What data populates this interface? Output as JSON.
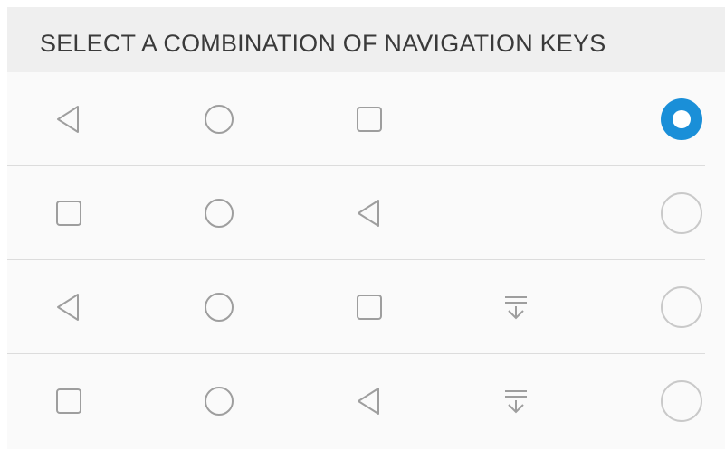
{
  "header": {
    "title": "SELECT A COMBINATION OF NAVIGATION KEYS"
  },
  "colors": {
    "accent": "#1a8fd8",
    "icon": "#9e9e9e",
    "divider": "#dcdcdc"
  },
  "options": [
    {
      "keys": [
        "back-icon",
        "home-icon",
        "recent-apps-icon"
      ],
      "selected": true
    },
    {
      "keys": [
        "recent-apps-icon",
        "home-icon",
        "back-icon"
      ],
      "selected": false
    },
    {
      "keys": [
        "back-icon",
        "home-icon",
        "recent-apps-icon",
        "notification-pull-down-icon"
      ],
      "selected": false
    },
    {
      "keys": [
        "recent-apps-icon",
        "home-icon",
        "back-icon",
        "notification-pull-down-icon"
      ],
      "selected": false
    }
  ]
}
